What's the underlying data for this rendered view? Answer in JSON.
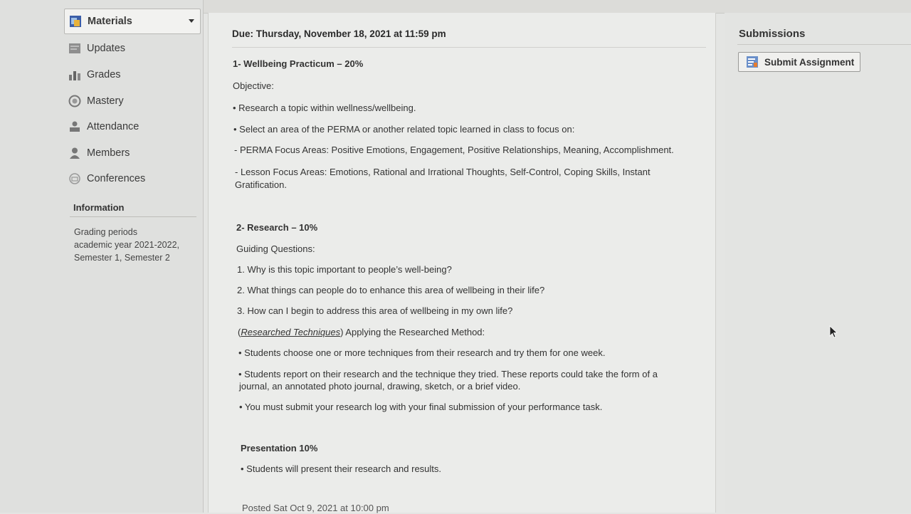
{
  "sidebar": {
    "items": [
      {
        "label": "Materials",
        "icon": "materials-icon"
      },
      {
        "label": "Updates",
        "icon": "updates-icon"
      },
      {
        "label": "Grades",
        "icon": "grades-icon"
      },
      {
        "label": "Mastery",
        "icon": "mastery-icon"
      },
      {
        "label": "Attendance",
        "icon": "attendance-icon"
      },
      {
        "label": "Members",
        "icon": "members-icon"
      },
      {
        "label": "Conferences",
        "icon": "conferences-icon"
      }
    ],
    "info_title": "Information",
    "grading_label": "Grading periods",
    "grading_value": "academic year 2021-2022, Semester 1, Semester 2"
  },
  "assignment": {
    "due": "Due: Thursday, November 18, 2021 at 11:59 pm",
    "section1_heading": "1- Wellbeing Practicum – 20%",
    "objective_label": "Objective:",
    "objective_bullet1": "• Research a topic within wellness/wellbeing.",
    "objective_bullet2": "• Select an area of the PERMA or another related topic learned in class to focus on:",
    "perma_areas": "- PERMA Focus Areas: Positive Emotions, Engagement, Positive Relationships, Meaning, Accomplishment.",
    "lesson_areas_line1": "- Lesson Focus Areas: Emotions, Rational and Irrational Thoughts, Self-Control, Coping Skills, Instant",
    "lesson_areas_line2": "Gratification.",
    "section2_heading": "2- Research – 10%",
    "guiding_label": "Guiding Questions:",
    "question1": "1. Why is this topic important to people’s well-being?",
    "question2": "2. What things can people do to enhance this area of wellbeing in their life?",
    "question3": "3. How can I begin to address this area of wellbeing in my own life?",
    "techniques_link": "Researched Techniques",
    "techniques_rest": ") Applying the Researched Method:",
    "bullet_choose": "• Students choose one or more techniques from their research and try them for one week.",
    "bullet_report_line1": "• Students report on their research and the technique they tried. These reports could take the form of a",
    "bullet_report_line2": "journal, an annotated photo journal, drawing, sketch, or a brief video.",
    "bullet_submit": "• You must submit your research log with your final submission of your performance task.",
    "presentation_heading": "Presentation 10%",
    "presentation_bullet": "• Students will present their research and results.",
    "posted": "Posted Sat Oct 9, 2021 at 10:00 pm"
  },
  "submissions": {
    "title": "Submissions",
    "button_label": "Submit Assignment"
  }
}
